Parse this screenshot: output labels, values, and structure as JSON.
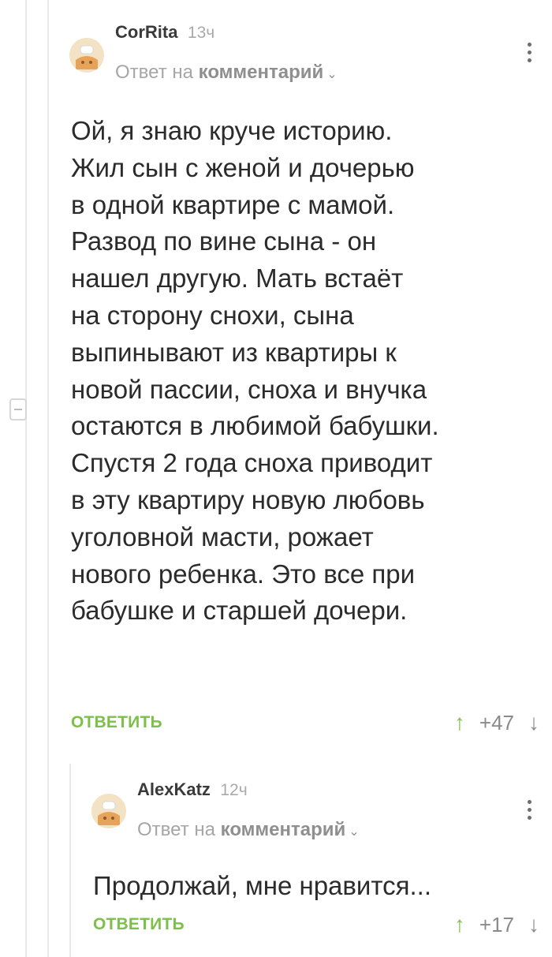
{
  "comments": [
    {
      "author": "CorRita",
      "time": "13ч",
      "reply_prefix": "Ответ на",
      "reply_link": "комментарий",
      "text_lines": [
        "Ой, я знаю круче историю.",
        "Жил сын с женой и дочерью",
        "в одной квартире с мамой.",
        "Развод по вине сына - он",
        "нашел другую. Мать встаёт",
        "на сторону снохи, сына",
        "выпинывают из квартиры к",
        "новой пассии, сноха и внучка",
        "остаются в любимой бабушки.",
        "Спустя 2 года сноха приводит",
        "в эту квартиру новую любовь",
        "уголовной масти, рожает",
        "нового ребенка. Это все при",
        "бабушке и старшей дочери."
      ],
      "reply_button": "ОТВЕТИТЬ",
      "rating": "+47"
    },
    {
      "author": "AlexKatz",
      "time": "12ч",
      "reply_prefix": "Ответ на",
      "reply_link": "комментарий",
      "text_lines": [
        "Продолжай, мне нравится..."
      ],
      "reply_button": "ОТВЕТИТЬ",
      "rating": "+17"
    }
  ],
  "icons": {
    "avatar": "default-avatar-icon",
    "menu": "kebab-menu-icon",
    "chevron": "chevron-down-icon",
    "upvote": "arrow-up-icon",
    "downvote": "arrow-down-icon",
    "collapse": "collapse-thread-icon"
  },
  "colors": {
    "accent_green": "#7cc04a",
    "muted_gray": "#a6a6a6",
    "text": "#2b2b2b"
  }
}
